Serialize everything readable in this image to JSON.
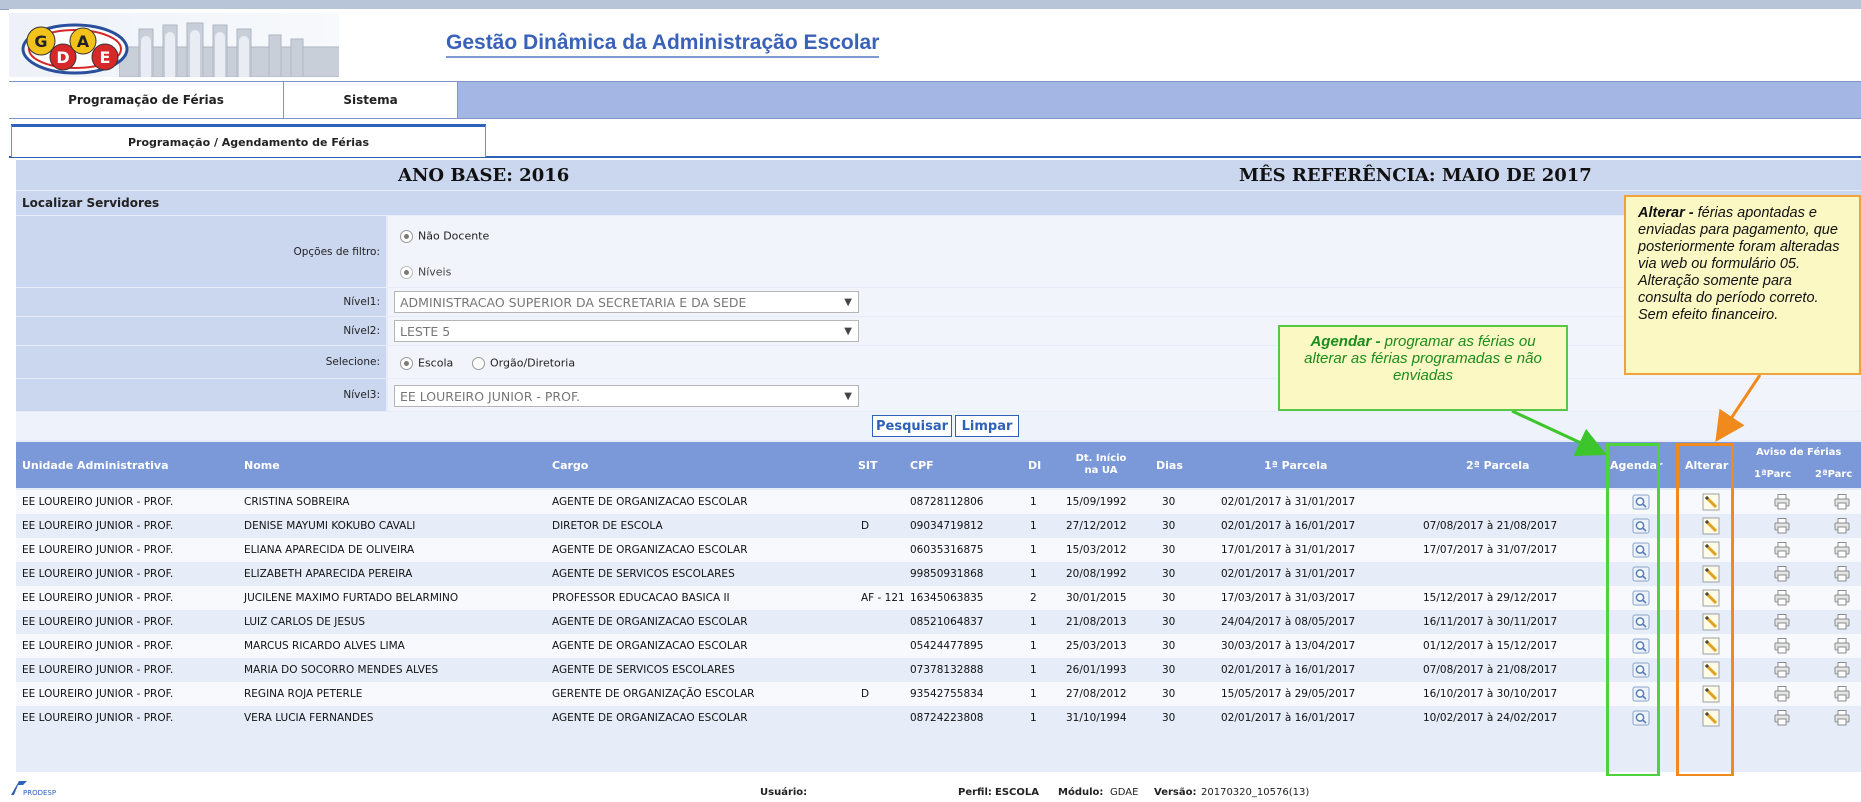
{
  "app": {
    "logo_text": "GDAE",
    "title": "Gestão Dinâmica da Administração Escolar"
  },
  "menu": [
    {
      "label": "Programação de Férias"
    },
    {
      "label": "Sistema"
    }
  ],
  "tab": {
    "label": "Programação / Agendamento de Férias"
  },
  "header": {
    "ano_base": "ANO BASE: 2016",
    "mes_referencia": "MÊS REFERÊNCIA: MAIO DE 2017"
  },
  "filter": {
    "section_title": "Localizar Servidores",
    "opcoes_label": "Opções de filtro:",
    "opt_nao_docente": "Não Docente",
    "opt_niveis": "Níveis",
    "nivel1_label": "Nível1:",
    "nivel1_value": "ADMINISTRACAO SUPERIOR DA SECRETARIA E DA SEDE",
    "nivel2_label": "Nível2:",
    "nivel2_value": "LESTE 5",
    "selecione_label": "Selecione:",
    "opt_escola": "Escola",
    "opt_orgao": "Orgão/Diretoria",
    "nivel3_label": "Nível3:",
    "nivel3_value": "EE LOUREIRO JUNIOR - PROF.",
    "btn_pesquisar": "Pesquisar",
    "btn_limpar": "Limpar"
  },
  "table": {
    "columns": {
      "unidade": "Unidade Administrativa",
      "nome": "Nome",
      "cargo": "Cargo",
      "sit": "SIT",
      "cpf": "CPF",
      "di": "DI",
      "dt_inicio_1": "Dt. Início",
      "dt_inicio_2": "na UA",
      "dias": "Dias",
      "parcela1": "1ª Parcela",
      "parcela2": "2ª Parcela",
      "agendar": "Agendar",
      "alterar": "Alterar",
      "aviso": "Aviso de Férias",
      "aviso_1": "1ªParc",
      "aviso_2": "2ªParc"
    },
    "rows": [
      {
        "unidade": "EE LOUREIRO JUNIOR - PROF.",
        "nome": "CRISTINA SOBREIRA",
        "cargo": "AGENTE DE ORGANIZACAO ESCOLAR",
        "sit": "",
        "cpf": "08728112806",
        "di": "1",
        "dt": "15/09/1992",
        "dias": "30",
        "p1": "02/01/2017 à 31/01/2017",
        "p2": ""
      },
      {
        "unidade": "EE LOUREIRO JUNIOR - PROF.",
        "nome": "DENISE MAYUMI KOKUBO CAVALI",
        "cargo": "DIRETOR DE ESCOLA",
        "sit": "D",
        "cpf": "09034719812",
        "di": "1",
        "dt": "27/12/2012",
        "dias": "30",
        "p1": "02/01/2017 à 16/01/2017",
        "p2": "07/08/2017 à 21/08/2017"
      },
      {
        "unidade": "EE LOUREIRO JUNIOR - PROF.",
        "nome": "ELIANA APARECIDA DE OLIVEIRA",
        "cargo": "AGENTE DE ORGANIZACAO ESCOLAR",
        "sit": "",
        "cpf": "06035316875",
        "di": "1",
        "dt": "15/03/2012",
        "dias": "30",
        "p1": "17/01/2017 à 31/01/2017",
        "p2": "17/07/2017 à 31/07/2017"
      },
      {
        "unidade": "EE LOUREIRO JUNIOR - PROF.",
        "nome": "ELIZABETH APARECIDA PEREIRA",
        "cargo": "AGENTE DE SERVICOS ESCOLARES",
        "sit": "",
        "cpf": "99850931868",
        "di": "1",
        "dt": "20/08/1992",
        "dias": "30",
        "p1": "02/01/2017 à 31/01/2017",
        "p2": ""
      },
      {
        "unidade": "EE LOUREIRO JUNIOR - PROF.",
        "nome": "JUCILENE MAXIMO FURTADO BELARMINO",
        "cargo": "PROFESSOR EDUCACAO BASICA II",
        "sit": "AF - 121",
        "cpf": "16345063835",
        "di": "2",
        "dt": "30/01/2015",
        "dias": "30",
        "p1": "17/03/2017 à 31/03/2017",
        "p2": "15/12/2017 à 29/12/2017"
      },
      {
        "unidade": "EE LOUREIRO JUNIOR - PROF.",
        "nome": "LUIZ CARLOS DE JESUS",
        "cargo": "AGENTE DE ORGANIZACAO ESCOLAR",
        "sit": "",
        "cpf": "08521064837",
        "di": "1",
        "dt": "21/08/2013",
        "dias": "30",
        "p1": "24/04/2017 à 08/05/2017",
        "p2": "16/11/2017 à 30/11/2017"
      },
      {
        "unidade": "EE LOUREIRO JUNIOR - PROF.",
        "nome": "MARCUS RICARDO ALVES LIMA",
        "cargo": "AGENTE DE ORGANIZACAO ESCOLAR",
        "sit": "",
        "cpf": "05424477895",
        "di": "1",
        "dt": "25/03/2013",
        "dias": "30",
        "p1": "30/03/2017 à 13/04/2017",
        "p2": "01/12/2017 à 15/12/2017"
      },
      {
        "unidade": "EE LOUREIRO JUNIOR - PROF.",
        "nome": "MARIA DO SOCORRO MENDES ALVES",
        "cargo": "AGENTE DE SERVICOS ESCOLARES",
        "sit": "",
        "cpf": "07378132888",
        "di": "1",
        "dt": "26/01/1993",
        "dias": "30",
        "p1": "02/01/2017 à 16/01/2017",
        "p2": "07/08/2017 à 21/08/2017"
      },
      {
        "unidade": "EE LOUREIRO JUNIOR - PROF.",
        "nome": "REGINA ROJA PETERLE",
        "cargo": "GERENTE DE ORGANIZAÇÃO ESCOLAR",
        "sit": "D",
        "cpf": "93542755834",
        "di": "1",
        "dt": "27/08/2012",
        "dias": "30",
        "p1": "15/05/2017 à 29/05/2017",
        "p2": "16/10/2017 à 30/10/2017"
      },
      {
        "unidade": "EE LOUREIRO JUNIOR - PROF.",
        "nome": "VERA LUCIA FERNANDES",
        "cargo": "AGENTE DE ORGANIZACAO ESCOLAR",
        "sit": "",
        "cpf": "08724223808",
        "di": "1",
        "dt": "31/10/1994",
        "dias": "30",
        "p1": "02/01/2017 à 16/01/2017",
        "p2": "10/02/2017 à 24/02/2017"
      }
    ]
  },
  "callouts": {
    "agendar_bold": "Agendar -",
    "agendar_text": " programar as férias ou alterar as férias programadas e não enviadas",
    "alterar_bold": "Alterar -",
    "alterar_text": " férias apontadas e enviadas para pagamento, que posteriormente foram alteradas via web ou formulário 05. Alteração somente para consulta do período correto. Sem efeito financeiro."
  },
  "footer": {
    "logo_text": "PRODESP",
    "usuario_label": "Usuário:",
    "perfil_label": "Perfil:",
    "perfil_value": "ESCOLA",
    "modulo_label": "Módulo:",
    "modulo_value": "GDAE",
    "versao_label": "Versão:",
    "versao_value": "20170320_10576(13)"
  },
  "colors": {
    "accent": "#2e62b8",
    "menu_bar": "#a3b6e4",
    "table_header": "#7b98d8",
    "highlight_agendar": "#4cd43a",
    "highlight_alterar": "#f08a1c"
  }
}
